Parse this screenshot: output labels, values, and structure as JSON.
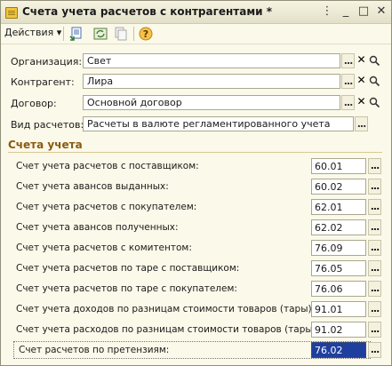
{
  "window": {
    "title": "Счета учета расчетов с контрагентами *"
  },
  "titlebar_icons": {
    "menu": "⋮",
    "minimize": "_",
    "maximize": "□",
    "close": "✕"
  },
  "toolbar": {
    "actions_label": "Действия",
    "actions_arrow": "▾",
    "help_glyph": "?"
  },
  "fields": [
    {
      "label": "Организация:",
      "value": "Свет"
    },
    {
      "label": "Контрагент:",
      "value": "Лира"
    },
    {
      "label": "Договор:",
      "value": "Основной договор"
    },
    {
      "label": "Вид расчетов:",
      "value": "Расчеты в валюте регламентированного учета"
    }
  ],
  "buttons": {
    "select": "...",
    "clear": "✕",
    "open": "🔍"
  },
  "group": {
    "title": "Счета учета"
  },
  "accounts": [
    {
      "label": "Счет учета расчетов с поставщиком:",
      "value": "60.01"
    },
    {
      "label": "Счет учета авансов выданных:",
      "value": "60.02"
    },
    {
      "label": "Счет учета расчетов с покупателем:",
      "value": "62.01"
    },
    {
      "label": "Счет учета авансов полученных:",
      "value": "62.02"
    },
    {
      "label": "Счет учета расчетов с комитентом:",
      "value": "76.09"
    },
    {
      "label": "Счет учета расчетов по таре с поставщиком:",
      "value": "76.05"
    },
    {
      "label": "Счет учета расчетов по таре с покупателем:",
      "value": "76.06"
    },
    {
      "label": "Счет учета доходов по разницам стоимости товаров (тары):",
      "value": "91.01"
    },
    {
      "label": "Счет учета расходов по разницам стоимости товаров (тары):",
      "value": "91.02"
    },
    {
      "label": "Счет расчетов по претензиям:",
      "value": "76.02"
    }
  ]
}
